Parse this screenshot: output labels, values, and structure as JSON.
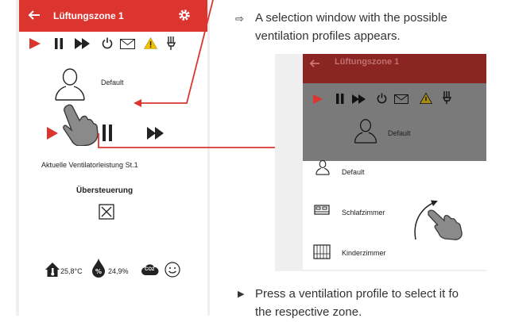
{
  "left_phone": {
    "title": "Lüftungszone 1",
    "profile_label": "Default",
    "status_text": "Aktuelle Ventilatorleistung St.1",
    "override_heading": "Übersteuerung",
    "temperature": "25,8°C",
    "humidity": "24,9%",
    "co2_badge": "CO2",
    "icons": [
      "back-arrow-icon",
      "settings-gear-icon",
      "play-icon",
      "pause-icon",
      "fast-forward-icon",
      "power-icon",
      "mail-icon",
      "warning-icon",
      "filter-icon",
      "user-icon",
      "hand-pointer-icon",
      "checkbox-icon",
      "house-thermometer-icon",
      "humidity-drop-icon",
      "co2-cloud-icon",
      "smiley-icon"
    ]
  },
  "instructions": {
    "bullet1_line1": "A selection window with the possible",
    "bullet1_line2": "ventilation profiles appears.",
    "bullet2_line1": "Press a ventilation profile to select it fo",
    "bullet2_line2": "the respective zone.",
    "arrow_symbol": "⇨",
    "triangle_symbol": "▶"
  },
  "right_phone": {
    "title": "Lüftungszone 1",
    "profile_label": "Default",
    "menu_items": [
      "Default",
      "Schlafzimmer",
      "Kinderzimmer"
    ]
  },
  "colors": {
    "brand_red": "#dc3530",
    "dimmed_red": "#8b2522",
    "overlay_grey": "#7a7a7a",
    "warning_yellow": "#f2c200"
  }
}
